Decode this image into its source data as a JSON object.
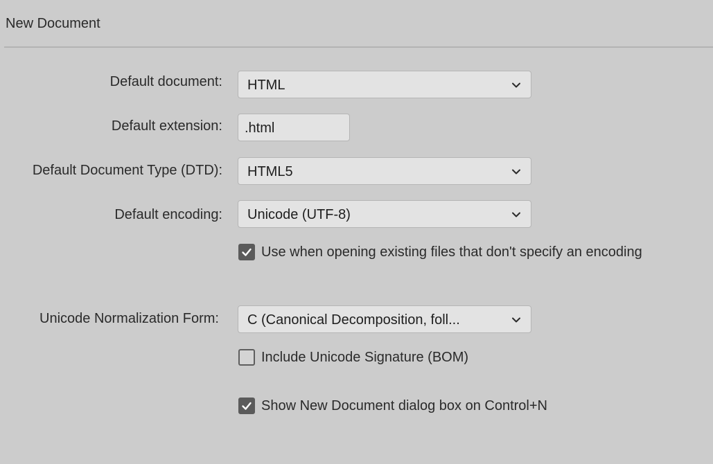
{
  "panel": {
    "title": "New Document"
  },
  "fields": {
    "default_document": {
      "label": "Default document:",
      "value": "HTML"
    },
    "default_extension": {
      "label": "Default extension:",
      "value": ".html"
    },
    "default_dtd": {
      "label": "Default Document Type (DTD):",
      "value": "HTML5"
    },
    "default_encoding": {
      "label": "Default encoding:",
      "value": "Unicode (UTF-8)"
    },
    "use_encoding_for_existing": {
      "label": "Use when opening existing files that don't specify an encoding",
      "checked": true
    },
    "normalization_form": {
      "label": "Unicode Normalization Form:",
      "value": "C (Canonical Decomposition, foll..."
    },
    "include_bom": {
      "label": "Include Unicode Signature (BOM)",
      "checked": false
    },
    "show_dialog": {
      "label": "Show New Document dialog box on Control+N",
      "checked": true
    }
  },
  "icons": {
    "dropdown": "chevron-down-icon",
    "check": "checkmark-icon"
  },
  "colors": {
    "background": "#cccccc",
    "control_background": "#e3e3e3",
    "checkbox_checked": "#5b5b5b"
  }
}
